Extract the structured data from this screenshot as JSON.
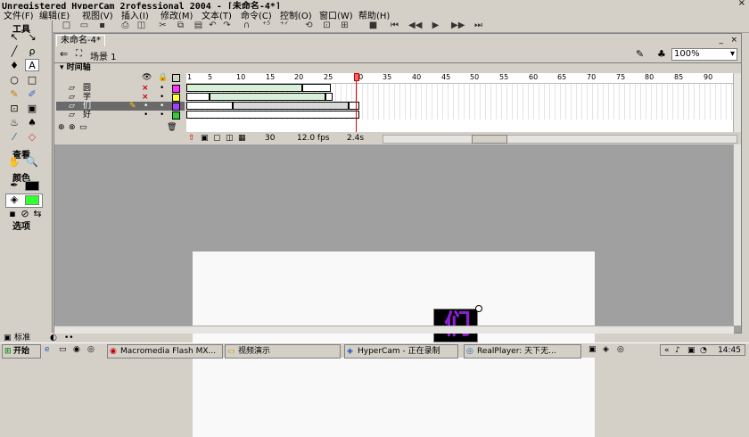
{
  "window": {
    "title": "Unregistered HyperCam 2rofessional 2004 - [未命名-4*]",
    "close": "×"
  },
  "menu": [
    "文件(F)",
    "编辑(E)",
    "视图(V)",
    "插入(I)",
    "修改(M)",
    "文本(T)",
    "命令(C)",
    "控制(O)",
    "窗口(W)",
    "帮助(H)"
  ],
  "tools_panel": {
    "header": "工具",
    "view_label": "查看",
    "colors_label": "颜色",
    "options_label": "选项"
  },
  "doc": {
    "tab": "未命名-4*",
    "scene": "场景 1",
    "zoom": "100%"
  },
  "timeline": {
    "header": "时间轴",
    "ruler_ticks": [
      "1",
      "5",
      "10",
      "15",
      "20",
      "25",
      "30",
      "35",
      "40",
      "45",
      "50",
      "55",
      "60",
      "65",
      "70",
      "75",
      "80",
      "85",
      "90"
    ],
    "layers": [
      {
        "name": "圆",
        "eye": "×",
        "lock": "•"
      },
      {
        "name": "学",
        "eye": "×",
        "lock": "•"
      },
      {
        "name": "们",
        "eye": "•",
        "lock": "•"
      },
      {
        "name": "好",
        "eye": "•",
        "lock": "•"
      }
    ],
    "status_frame": "30",
    "status_fps": "12.0 fps",
    "status_time": "2.4s"
  },
  "stage": {
    "symbol_text": "们"
  },
  "bottom_left": {
    "label": "标准"
  },
  "taskbar": {
    "start": "开始",
    "items": [
      "Macromedia Flash MX...",
      "视频演示",
      "HyperCam - 正在录制",
      "RealPlayer: 天下无..."
    ],
    "clock": "14:45"
  },
  "colors": {
    "stroke": "#000000",
    "fill": "#33ff33",
    "symbol_bg": "#000000",
    "symbol_text": "#8a1fd2"
  }
}
